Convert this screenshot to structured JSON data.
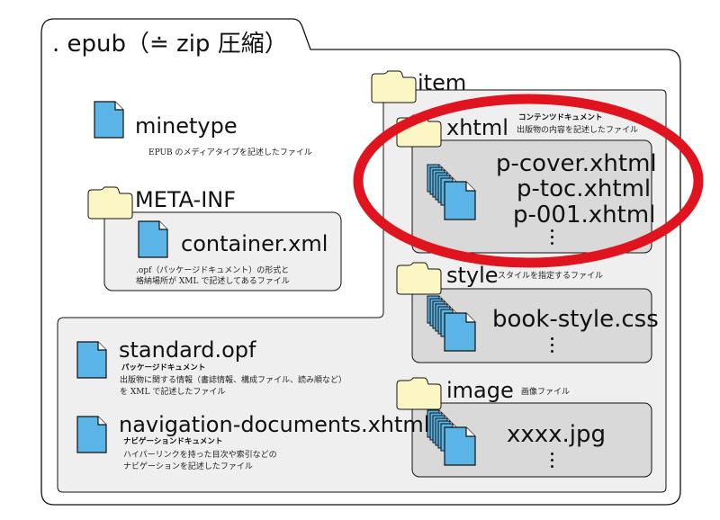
{
  "root": {
    "title": ". epub（≐ zip 圧縮）"
  },
  "minetype": {
    "name": "minetype",
    "desc": "EPUB のメディアタイプを記述したファイル"
  },
  "meta_inf": {
    "name": "META-INF",
    "file": "container.xml",
    "desc_line1": ".opf（パッケージドキュメント）の形式と",
    "desc_line2": "格納場所が XML で記述してあるファイル"
  },
  "standard_opf": {
    "name": "standard.opf",
    "kind": "パッケージドキュメント",
    "desc_line1": "出版物に関する情報（書誌情報、構成ファイル、読み順など）",
    "desc_line2": "を XML で記述したファイル"
  },
  "nav_doc": {
    "name": "navigation-documents.xhtml",
    "kind": "ナビゲーションドキュメント",
    "desc_line1": "ハイパーリンクを持った目次や索引などの",
    "desc_line2": "ナビゲーションを記述したファイル"
  },
  "item": {
    "name": "item",
    "xhtml": {
      "name": "xhtml",
      "kind": "コンテンツドキュメント",
      "desc": "出版物の内容を記述したファイル",
      "files": [
        "p-cover.xhtml",
        "p-toc.xhtml",
        "p-001.xhtml"
      ]
    },
    "style": {
      "name": "style",
      "desc": "スタイルを指定するファイル",
      "files": [
        "book-style.css"
      ]
    },
    "image": {
      "name": "image",
      "desc": "画像ファイル",
      "files": [
        "xxxx.jpg"
      ]
    }
  },
  "colors": {
    "file_fill": "#5ab4e5",
    "folder_fill": "#fbf6c3",
    "panel_fill": "#efefef",
    "inner_panel_fill": "#d9d9d9",
    "highlight": "#e0141e"
  }
}
